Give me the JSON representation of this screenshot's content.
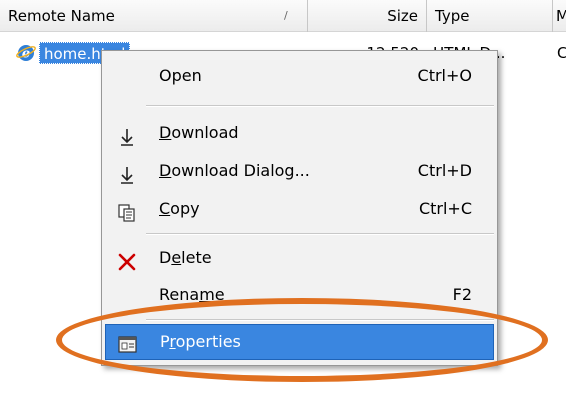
{
  "columns": {
    "name": "Remote Name",
    "sort_indicator": "/",
    "size": "Size",
    "type": "Type",
    "more": "M"
  },
  "file": {
    "name": "home.html",
    "size": "12,520",
    "type": "HTML D...",
    "more": "C",
    "icon": "ie-html-icon"
  },
  "menu": {
    "items": [
      {
        "label_pre": "",
        "label_ul": "",
        "label_post": "Open",
        "shortcut": "Ctrl+O",
        "icon": ""
      },
      {
        "label_pre": "",
        "label_ul": "D",
        "label_post": "ownload",
        "shortcut": "",
        "icon": "download-icon"
      },
      {
        "label_pre": "",
        "label_ul": "D",
        "label_post": "ownload Dialog...",
        "shortcut": "Ctrl+D",
        "icon": "download-icon"
      },
      {
        "label_pre": "",
        "label_ul": "C",
        "label_post": "opy",
        "shortcut": "Ctrl+C",
        "icon": "copy-icon"
      },
      {
        "label_pre": "D",
        "label_ul": "e",
        "label_post": "lete",
        "shortcut": "",
        "icon": "delete-x-icon"
      },
      {
        "label_pre": "Rena",
        "label_ul": "m",
        "label_post": "e",
        "shortcut": "F2",
        "icon": ""
      },
      {
        "label_pre": "P",
        "label_ul": "r",
        "label_post": "operties",
        "shortcut": "",
        "icon": "properties-icon"
      }
    ]
  },
  "colors": {
    "selection": "#3a86e0",
    "highlight_ring": "#e07020",
    "delete_icon": "#cc0000"
  }
}
